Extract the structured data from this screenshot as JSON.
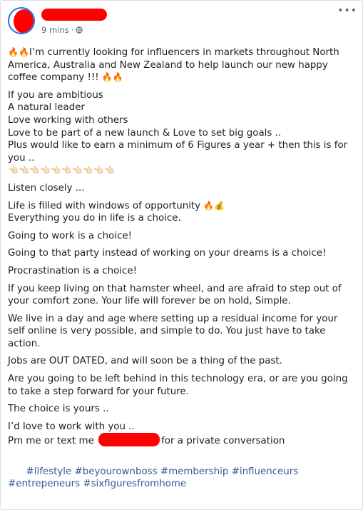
{
  "post": {
    "time": "9 mins",
    "time_separator": "·",
    "more_icon": "•••",
    "fire_pair": "🔥🔥",
    "point_row": "👈🏻👈🏻👈🏻👈🏻👈🏻👈🏻👈🏻👈🏻👈🏻👈🏻",
    "money_emoji": "💰",
    "fire_single": "🔥",
    "lines": {
      "intro": "I’m currently looking for influencers in markets throughout North America, Australia and New Zealand to help launch our new happy coffee company !!! ",
      "list_1": "If you are ambitious\nA natural leader\nLove working with others\nLove to be part of a new launch & Love to set big goals ..\nPlus would like to earn a minimum of 6 Figures a year + then this is for you ..",
      "listen": "Listen closely ...",
      "life_1": "Life is filled with windows of opportunity ",
      "life_2": "Everything you do in life is a choice.",
      "work": "Going to work is a choice!",
      "party": "Going to that party instead of working on your dreams is a choice!",
      "procrastination": "Procrastination is a choice!",
      "hamster": "If you keep living on that hamster wheel, and are afraid to step out of your comfort zone. Your life will forever be on hold, Simple.",
      "residual": "We live in a day and age where setting up a residual income for your self online is very possible, and simple to do. You just have to take action.",
      "jobs": "Jobs are OUT DATED, and will soon be a thing of the past.",
      "technology": "Are you going to be left behind in this technology era, or are you going to take a step forward for your future.",
      "choice": "The choice is yours ..",
      "love_work": "I’d love to work with you ..",
      "pm_before": "Pm me or text me ",
      "pm_after": "for a private conversation"
    },
    "hashtags": [
      "#lifestyle",
      "#beyourownboss",
      "#membership",
      "#influenceurs",
      "#entrepeneurs",
      "#sixfiguresfromhome"
    ]
  }
}
